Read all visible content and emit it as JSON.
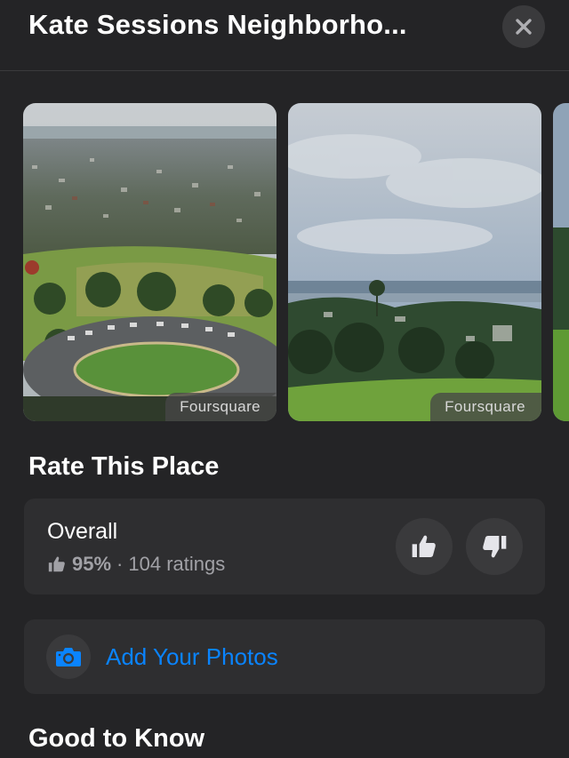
{
  "header": {
    "title": "Kate Sessions Neighborho...",
    "close_icon": "close-icon"
  },
  "photos": [
    {
      "source": "Foursquare"
    },
    {
      "source": "Foursquare"
    },
    {
      "source": ""
    }
  ],
  "rate_section": {
    "heading": "Rate This Place",
    "overall_label": "Overall",
    "percent": "95%",
    "separator": "·",
    "ratings_count": "104 ratings",
    "thumb_up_icon": "thumbs-up-icon",
    "thumb_down_icon": "thumbs-down-icon"
  },
  "add_photos": {
    "label": "Add Your Photos",
    "icon": "camera-icon"
  },
  "good_to_know": {
    "heading": "Good to Know"
  },
  "colors": {
    "background": "#242426",
    "card": "#2e2e30",
    "accent": "#0a84ff",
    "secondary_text": "#a1a1a6"
  }
}
